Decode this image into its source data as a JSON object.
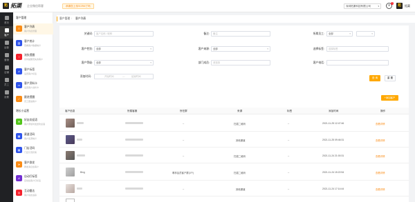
{
  "header": {
    "logo_mark": "拓",
    "logo_text": "拓渠",
    "subtitle": "企业微信帮客",
    "notice": "恭喜您上传SCRM了吗",
    "company": "深圳拓渠科技有限公司",
    "notice_count": "1",
    "user_mark": "拓",
    "user_name": "拓渠"
  },
  "rail": [
    {
      "label": "首页",
      "icon": "home-icon"
    },
    {
      "label": "客户",
      "icon": "customer-icon"
    },
    {
      "label": "运营",
      "icon": "operation-icon"
    },
    {
      "label": "营销",
      "icon": "marketing-icon"
    },
    {
      "label": "店铺",
      "icon": "shop-icon"
    },
    {
      "label": "员工",
      "icon": "staff-icon"
    },
    {
      "label": "设置",
      "icon": "settings-icon"
    }
  ],
  "sidenav": {
    "section1": "客户管理",
    "section2": "增长小运营",
    "items1": [
      {
        "title": "客户列表",
        "sub": "客户列表管理",
        "color": "#fa8c16",
        "icon": "customer-list-icon"
      },
      {
        "title": "客户统计",
        "sub": "查看客户数据统计",
        "color": "#2f54eb",
        "icon": "chart-icon"
      },
      {
        "title": "流失提醒",
        "sub": "实时提醒流失的客户",
        "color": "#f5222d",
        "icon": "alert-icon"
      },
      {
        "title": "客户标签",
        "sub": "设置客户标签",
        "color": "#2f54eb",
        "icon": "tag-icon"
      },
      {
        "title": "客户资料卡",
        "sub": "设置客户资料卡",
        "color": "#2f54eb",
        "icon": "card-icon"
      },
      {
        "title": "跟进提醒",
        "sub": "员工跟进客户",
        "color": "#fa8c16",
        "icon": "follow-up-icon"
      }
    ],
    "items2": [
      {
        "title": "好友欢迎语",
        "sub": "客户添加时发送欢迎语",
        "color": "#52c41a",
        "icon": "welcome-icon"
      },
      {
        "title": "渠道活码",
        "sub": "客户来源统计",
        "color": "#2f54eb",
        "icon": "qrcode-icon"
      },
      {
        "title": "门店活码",
        "sub": "门店引流获客",
        "color": "#2f54eb",
        "icon": "store-qrcode-icon"
      },
      {
        "title": "客户群发",
        "sub": "群发消息给客户",
        "color": "#fa8c16",
        "icon": "broadcast-icon"
      },
      {
        "title": "自动打标签",
        "sub": "自动给客户打标签",
        "color": "#722ed1",
        "icon": "auto-tag-icon"
      },
      {
        "title": "互动雷达",
        "sub": "客户动态追踪",
        "color": "#f5222d",
        "icon": "radar-icon"
      }
    ]
  },
  "breadcrumb": {
    "parent": "客户管理",
    "current": "客户列表"
  },
  "filters": {
    "keyword_label": "关键词:",
    "keyword_placeholder": "客户名称 / 昵称",
    "remark_label": "备注:",
    "remark_placeholder": "备注",
    "owner_label": "所属员工:",
    "owner_value": "全部",
    "owner_extra": "",
    "gender_label": "客户性别:",
    "gender_value": "全部",
    "source_label": "客户来源:",
    "source_value": "全部",
    "tag_label": "选择标签:",
    "tag_placeholder": "选择标签",
    "level_label": "客户等级:",
    "level_value": "全部",
    "dept_label": "部门成员:",
    "dept_placeholder": "请选择",
    "phone_label": "客户电话:",
    "phone_placeholder": "",
    "date_label": "添加时间:",
    "date_start": "开始时间",
    "date_sep": "—",
    "date_end": "结束时间",
    "search_button": "查 询",
    "reset_button": "重 置",
    "add_button": "+添加客户"
  },
  "table": {
    "columns": [
      "客户信息",
      "所属客服",
      "所在群",
      "来源",
      "标签",
      "添加时间",
      "操作"
    ],
    "rows": [
      {
        "name": "",
        "owner": "",
        "group": "--",
        "source": "扫描二维码",
        "tag": "--",
        "time": "2021-11-25 12:47:46",
        "action": "查看详情"
      },
      {
        "name": "",
        "owner": "",
        "group": "--",
        "source": "其他渠道",
        "tag": "--",
        "time": "2021-11-25 09:46:31",
        "action": "查看详情"
      },
      {
        "name": "",
        "owner": "",
        "group": "--",
        "source": "扫描二维码",
        "tag": "--",
        "time": "2021-11-24 21:00:31",
        "action": "查看详情"
      },
      {
        "name": "Bing",
        "owner": "",
        "group": "尊享会员客户群(3个)",
        "source": "扫描二维码",
        "tag": "--",
        "time": "2021-11-24 15:22:54",
        "action": "查看详情"
      },
      {
        "name": "",
        "owner": "",
        "group": "--",
        "source": "其他渠道",
        "tag": "--",
        "time": "2021-11-24 17:14:44",
        "action": "查看详情"
      }
    ]
  },
  "colors": {
    "accent": "#ffa800",
    "link": "#fa8c16",
    "rail": "#202124"
  }
}
